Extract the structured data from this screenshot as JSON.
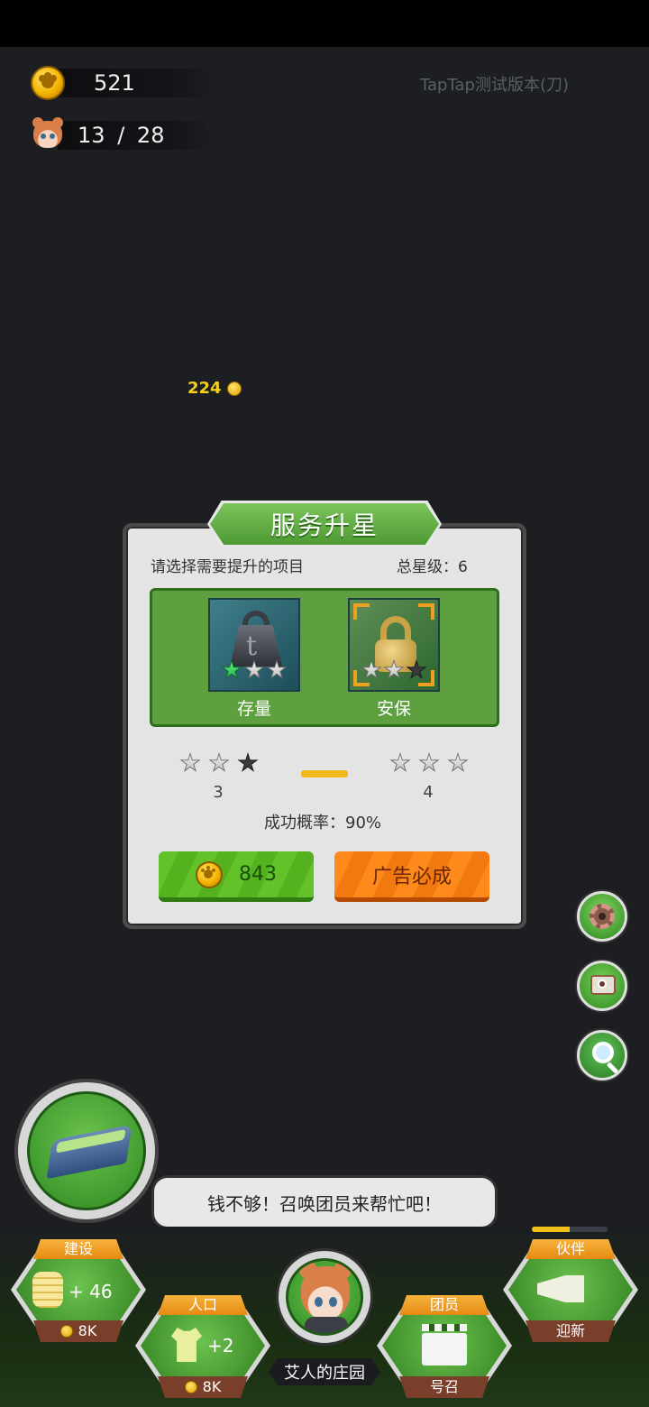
{
  "resources": {
    "coins": "521",
    "population_current": "13",
    "population_sep": "/",
    "population_max": "28"
  },
  "version_label": "TapTap测试版本(刀)",
  "floating_reward": "224",
  "dialog": {
    "title": "服务升星",
    "prompt": "请选择需要提升的项目",
    "total_stars_label": "总星级：6",
    "items": [
      {
        "label": "存量",
        "icon": "weight-icon",
        "stars": [
          1,
          0,
          0
        ]
      },
      {
        "label": "安保",
        "icon": "lock-icon",
        "stars": [
          0,
          0,
          0
        ],
        "selected": true
      }
    ],
    "current_level": "3",
    "next_level": "4",
    "success_rate": "成功概率：90%",
    "cost_button": "843",
    "ad_button": "广告必成"
  },
  "speech_bubble": "钱不够！召唤团员来帮忙吧！",
  "bottom_nav": {
    "build": {
      "tag": "建设",
      "value": "+ 46",
      "cost": "8K"
    },
    "population": {
      "tag": "人口",
      "value": "+2",
      "cost": "8K"
    },
    "manor": {
      "label": "艾人的庄园"
    },
    "members": {
      "tag": "团员",
      "foot": "号召"
    },
    "partner": {
      "tag": "伙伴",
      "foot": "迎新",
      "progress": 0.5
    }
  },
  "colors": {
    "accent_green": "#5e9f3f",
    "accent_orange": "#f27810",
    "star_yellow": "#f2b81a",
    "background": "#1c1e21"
  }
}
